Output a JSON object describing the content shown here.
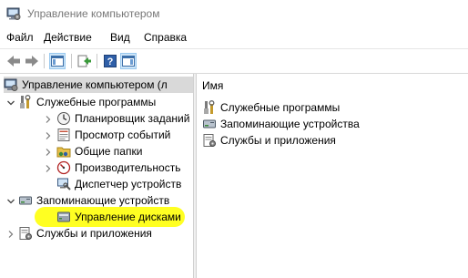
{
  "window": {
    "title": "Управление компьютером",
    "app_icon": "computer-management-icon"
  },
  "menu": [
    "Файл",
    "Действие",
    "Вид",
    "Справка"
  ],
  "toolbar": {
    "icons": [
      "back-arrow-icon",
      "forward-arrow-icon",
      "show-hide-tree-icon",
      "export-list-icon",
      "help-icon",
      "show-hide-action-pane-icon"
    ]
  },
  "tree": {
    "root": "Управление компьютером (л",
    "system_tools": {
      "label": "Служебные программы",
      "children": [
        "Планировщик заданий",
        "Просмотр событий",
        "Общие папки",
        "Производительность",
        "Диспетчер устройств"
      ]
    },
    "storage": {
      "label": "Запоминающие устройств",
      "children": [
        "Управление дисками"
      ]
    },
    "services": {
      "label": "Службы и приложения"
    }
  },
  "list": {
    "column_header": "Имя",
    "items": [
      "Служебные программы",
      "Запоминающие устройства",
      "Службы и приложения"
    ]
  },
  "colors": {
    "highlight": "#ffff22",
    "selected_root": "#d9d9d9"
  }
}
